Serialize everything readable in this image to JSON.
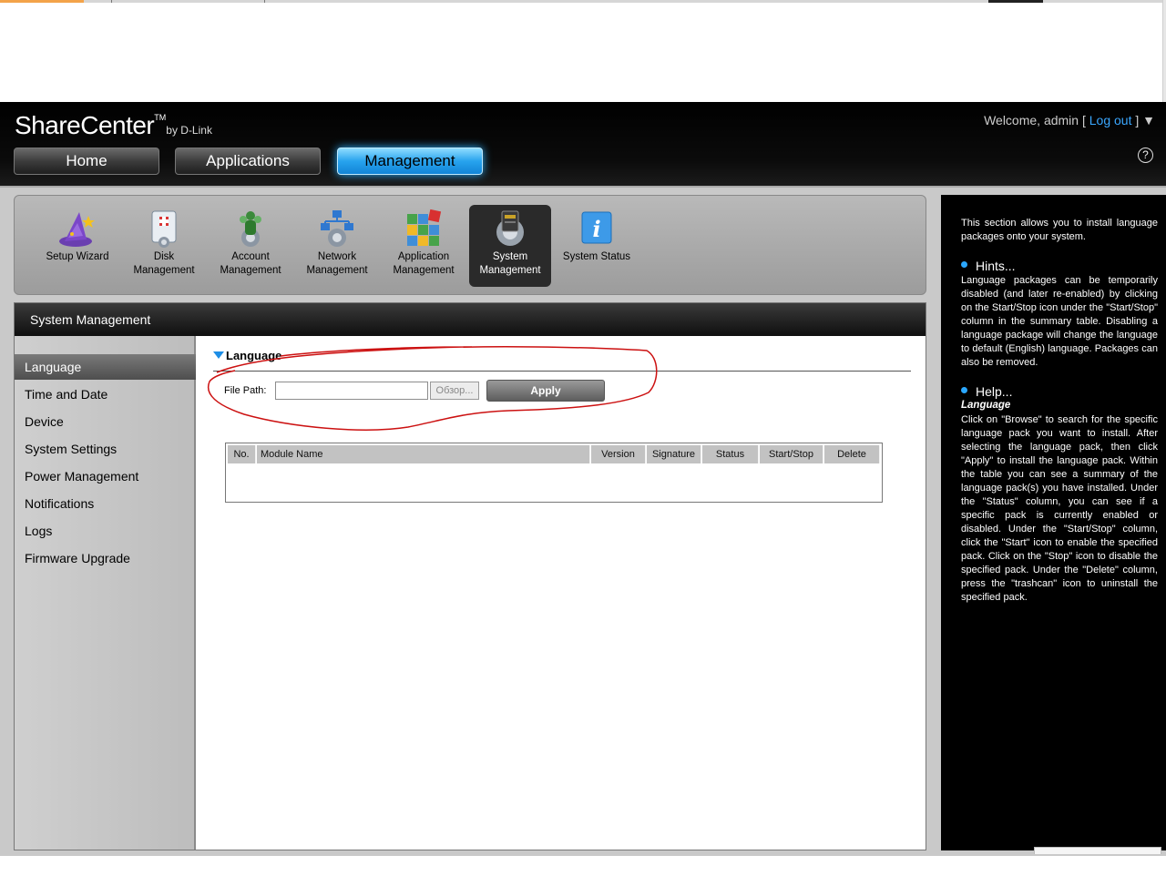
{
  "header": {
    "brand_name": "ShareCenter",
    "brand_tm": "TM",
    "brand_by": "by D-Link",
    "welcome_prefix": "Welcome, admin [ ",
    "logout_label": "Log out",
    "welcome_suffix": " ] ▼",
    "help_symbol": "?"
  },
  "nav_tabs": [
    {
      "label": "Home",
      "active": false
    },
    {
      "label": "Applications",
      "active": false
    },
    {
      "label": "Management",
      "active": true
    }
  ],
  "toolbar": [
    {
      "label": "Setup Wizard",
      "icon": "wizard-hat-icon"
    },
    {
      "label": "Disk Management",
      "icon": "disk-icon"
    },
    {
      "label": "Account Management",
      "icon": "account-icon"
    },
    {
      "label": "Network Management",
      "icon": "network-icon"
    },
    {
      "label": "Application Management",
      "icon": "application-icon"
    },
    {
      "label": "System Management",
      "icon": "system-gear-icon",
      "selected": true
    },
    {
      "label": "System Status",
      "icon": "info-icon"
    }
  ],
  "panel_title": "System Management",
  "sidebar": [
    {
      "label": "Language",
      "selected": true
    },
    {
      "label": "Time and Date"
    },
    {
      "label": "Device"
    },
    {
      "label": "System Settings"
    },
    {
      "label": "Power Management"
    },
    {
      "label": "Notifications"
    },
    {
      "label": "Logs"
    },
    {
      "label": "Firmware Upgrade"
    }
  ],
  "language": {
    "section_title": "Language",
    "file_path_label": "File Path:",
    "file_path_value": "",
    "browse_label": "Обзор...",
    "apply_label": "Apply",
    "table_headers": [
      "No.",
      "Module Name",
      "Version",
      "Signature",
      "Status",
      "Start/Stop",
      "Delete"
    ]
  },
  "help": {
    "intro": "This section allows you to install language packages onto your system.",
    "hints_title": "Hints...",
    "hints_text": "Language packages can be temporarily disabled (and later re-enabled) by clicking on the Start/Stop icon under the \"Start/Stop\" column in the summary table. Disabling a language package will change the language to default (English) language. Packages can also be removed.",
    "help_title": "Help...",
    "help_subtitle": "Language",
    "help_text": "Click on \"Browse\" to search for the specific language pack you want to install. After selecting the language pack, then click \"Apply\" to install the language pack. Within the table you can see a summary of the language pack(s) you have installed. Under the \"Status\" column, you can see if a specific pack is currently enabled or disabled. Under the \"Start/Stop\" column, click the \"Start\" icon to enable the specified pack. Click on the \"Stop\" icon to disable the specified pack. Under the \"Delete\" column, press the \"trashcan\" icon to uninstall the specified pack."
  },
  "colors": {
    "accent": "#27a3ee",
    "annotation": "#cc1111"
  }
}
